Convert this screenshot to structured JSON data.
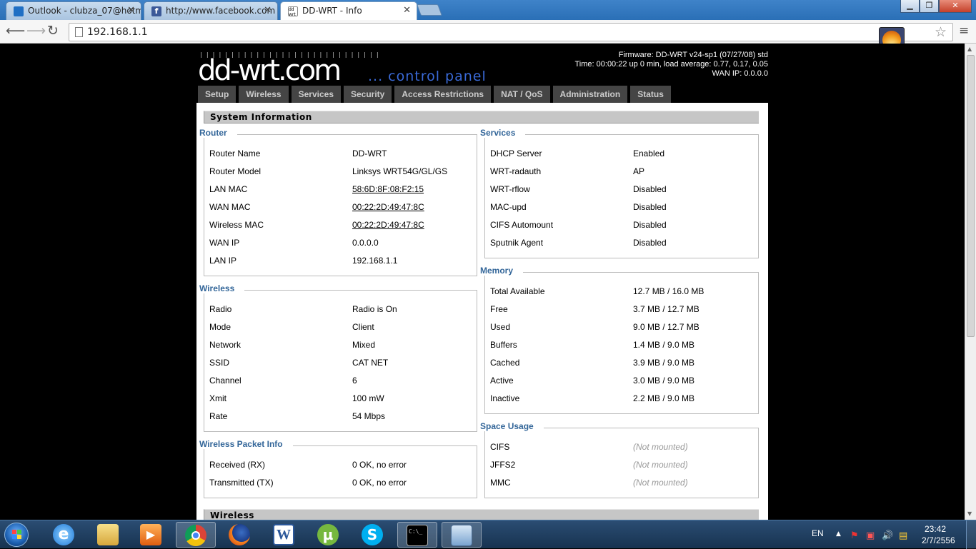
{
  "browser": {
    "tabs": [
      {
        "title": "Outlook - clubza_07@hotm",
        "icon": "outlook-icon"
      },
      {
        "title": "http://www.facebook.com",
        "icon": "facebook-icon"
      },
      {
        "title": "DD-WRT - Info",
        "icon": "ddwrt-icon"
      }
    ],
    "url": "192.168.1.1",
    "window_controls": {
      "minimize": "▁",
      "maximize": "❐",
      "close": "✕"
    }
  },
  "header": {
    "logo_main": "dd-wrt.com",
    "logo_sub": "... control panel",
    "firmware": "Firmware: DD-WRT v24-sp1 (07/27/08) std",
    "time": "Time: 00:00:22 up 0 min, load average: 0.77, 0.17, 0.05",
    "wan_ip": "WAN IP: 0.0.0.0"
  },
  "menu": [
    "Setup",
    "Wireless",
    "Services",
    "Security",
    "Access Restrictions",
    "NAT / QoS",
    "Administration",
    "Status"
  ],
  "system_info": {
    "title": "System Information",
    "router": {
      "title": "Router",
      "rows": [
        {
          "k": "Router Name",
          "v": "DD-WRT"
        },
        {
          "k": "Router Model",
          "v": "Linksys WRT54G/GL/GS"
        },
        {
          "k": "LAN MAC",
          "v": "58:6D:8F:08:F2:15"
        },
        {
          "k": "WAN MAC",
          "v": "00:22:2D:49:47:8C"
        },
        {
          "k": "Wireless MAC",
          "v": "00:22:2D:49:47:8C"
        },
        {
          "k": "WAN IP",
          "v": "0.0.0.0"
        },
        {
          "k": "LAN IP",
          "v": "192.168.1.1"
        }
      ]
    },
    "wireless": {
      "title": "Wireless",
      "rows": [
        {
          "k": "Radio",
          "v": "Radio is On"
        },
        {
          "k": "Mode",
          "v": "Client"
        },
        {
          "k": "Network",
          "v": "Mixed"
        },
        {
          "k": "SSID",
          "v": "CAT NET"
        },
        {
          "k": "Channel",
          "v": "6"
        },
        {
          "k": "Xmit",
          "v": "100 mW"
        },
        {
          "k": "Rate",
          "v": "54 Mbps"
        }
      ]
    },
    "packet_info": {
      "title": "Wireless Packet Info",
      "rows": [
        {
          "k": "Received (RX)",
          "v": "0 OK, no error"
        },
        {
          "k": "Transmitted (TX)",
          "v": "0 OK, no error"
        }
      ]
    },
    "services": {
      "title": "Services",
      "rows": [
        {
          "k": "DHCP Server",
          "v": "Enabled"
        },
        {
          "k": "WRT-radauth",
          "v": "AP"
        },
        {
          "k": "WRT-rflow",
          "v": "Disabled"
        },
        {
          "k": "MAC-upd",
          "v": "Disabled"
        },
        {
          "k": "CIFS Automount",
          "v": "Disabled"
        },
        {
          "k": "Sputnik Agent",
          "v": "Disabled"
        }
      ]
    },
    "memory": {
      "title": "Memory",
      "rows": [
        {
          "k": "Total Available",
          "v": "12.7 MB / 16.0 MB"
        },
        {
          "k": "Free",
          "v": "3.7 MB / 12.7 MB"
        },
        {
          "k": "Used",
          "v": "9.0 MB / 12.7 MB"
        },
        {
          "k": "Buffers",
          "v": "1.4 MB / 9.0 MB"
        },
        {
          "k": "Cached",
          "v": "3.9 MB / 9.0 MB"
        },
        {
          "k": "Active",
          "v": "3.0 MB / 9.0 MB"
        },
        {
          "k": "Inactive",
          "v": "2.2 MB / 9.0 MB"
        }
      ]
    },
    "space_usage": {
      "title": "Space Usage",
      "rows": [
        {
          "k": "CIFS",
          "v": "(Not mounted)"
        },
        {
          "k": "JFFS2",
          "v": "(Not mounted)"
        },
        {
          "k": "MMC",
          "v": "(Not mounted)"
        }
      ]
    }
  },
  "next_section_title": "Wireless",
  "taskbar": {
    "apps": [
      "ie-icon",
      "explorer-icon",
      "media-player-icon",
      "chrome-icon",
      "firefox-icon",
      "word-icon",
      "utorrent-icon",
      "skype-icon",
      "cmd-icon",
      "control-panel-icon"
    ],
    "language": "EN",
    "time": "23:42",
    "date": "2/7/2556"
  },
  "colors": {
    "accent": "#336699",
    "menu_bg": "#454545",
    "section_head": "#c6c6c6"
  }
}
